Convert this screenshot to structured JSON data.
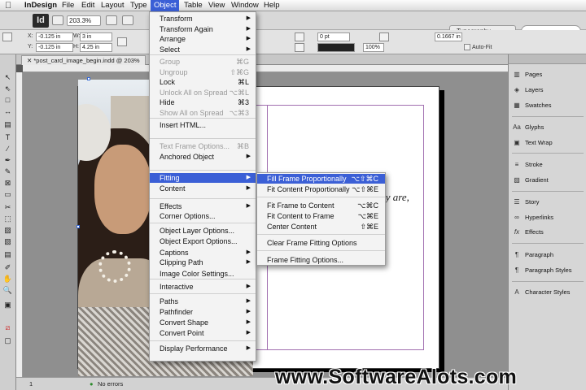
{
  "menubar": {
    "apple": "",
    "items": [
      "InDesign",
      "File",
      "Edit",
      "Layout",
      "Type",
      "Object",
      "Table",
      "View",
      "Window",
      "Help"
    ]
  },
  "toolbar": {
    "logo": "Id",
    "zoom": "203.3%",
    "workspace": "Typography"
  },
  "control": {
    "x_label": "X:",
    "x_value": "-0.125 in",
    "y_label": "Y:",
    "y_value": "-0.125 in",
    "w_label": "W:",
    "w_value": "3 in",
    "h_label": "H:",
    "h_value": "4.25 in",
    "stroke_weight": "0 pt",
    "percent": "100%",
    "measure": "0.1667 in",
    "autofit": "Auto-Fit"
  },
  "document_tab": "*post_card_image_begin.indd @ 203%",
  "canvas_text": "ey are,",
  "statusbar": {
    "page": "1",
    "errors": "No errors"
  },
  "watermark": "www.SoftwareAlots.com",
  "panels": [
    {
      "icon": "pages-icon",
      "label": "Pages"
    },
    {
      "icon": "layers-icon",
      "label": "Layers"
    },
    {
      "icon": "swatches-icon",
      "label": "Swatches"
    },
    {
      "icon": "glyphs-icon",
      "label": "Glyphs"
    },
    {
      "icon": "text-wrap-icon",
      "label": "Text Wrap"
    },
    {
      "icon": "stroke-icon",
      "label": "Stroke"
    },
    {
      "icon": "gradient-icon",
      "label": "Gradient"
    },
    {
      "icon": "story-icon",
      "label": "Story"
    },
    {
      "icon": "hyperlinks-icon",
      "label": "Hyperlinks"
    },
    {
      "icon": "effects-icon",
      "label": "Effects"
    },
    {
      "icon": "paragraph-icon",
      "label": "Paragraph"
    },
    {
      "icon": "paragraph-styles-icon",
      "label": "Paragraph Styles"
    },
    {
      "icon": "character-styles-icon",
      "label": "Character Styles"
    }
  ],
  "object_menu": [
    {
      "label": "Transform",
      "shortcut": "",
      "submenu": true,
      "disabled": false
    },
    {
      "label": "Transform Again",
      "shortcut": "",
      "submenu": true,
      "disabled": false
    },
    {
      "label": "Arrange",
      "shortcut": "",
      "submenu": true,
      "disabled": false
    },
    {
      "label": "Select",
      "shortcut": "",
      "submenu": true,
      "disabled": false
    },
    {
      "label": "Group",
      "shortcut": "⌘G",
      "submenu": false,
      "disabled": true
    },
    {
      "label": "Ungroup",
      "shortcut": "⇧⌘G",
      "submenu": false,
      "disabled": true
    },
    {
      "label": "Lock",
      "shortcut": "⌘L",
      "submenu": false,
      "disabled": false
    },
    {
      "label": "Unlock All on Spread",
      "shortcut": "⌥⌘L",
      "submenu": false,
      "disabled": true
    },
    {
      "label": "Hide",
      "shortcut": "⌘3",
      "submenu": false,
      "disabled": false
    },
    {
      "label": "Show All on Spread",
      "shortcut": "⌥⌘3",
      "submenu": false,
      "disabled": true
    },
    {
      "label": "Insert HTML...",
      "shortcut": "",
      "submenu": false,
      "disabled": false
    },
    {
      "label": "Text Frame Options...",
      "shortcut": "⌘B",
      "submenu": false,
      "disabled": true
    },
    {
      "label": "Anchored Object",
      "shortcut": "",
      "submenu": true,
      "disabled": false
    },
    {
      "label": "Fitting",
      "shortcut": "",
      "submenu": true,
      "disabled": false,
      "highlighted": true
    },
    {
      "label": "Content",
      "shortcut": "",
      "submenu": true,
      "disabled": false
    },
    {
      "label": "Effects",
      "shortcut": "",
      "submenu": true,
      "disabled": false
    },
    {
      "label": "Corner Options...",
      "shortcut": "",
      "submenu": false,
      "disabled": false
    },
    {
      "label": "Object Layer Options...",
      "shortcut": "",
      "submenu": false,
      "disabled": false
    },
    {
      "label": "Object Export Options...",
      "shortcut": "",
      "submenu": false,
      "disabled": false
    },
    {
      "label": "Captions",
      "shortcut": "",
      "submenu": true,
      "disabled": false
    },
    {
      "label": "Clipping Path",
      "shortcut": "",
      "submenu": true,
      "disabled": false
    },
    {
      "label": "Image Color Settings...",
      "shortcut": "",
      "submenu": false,
      "disabled": false
    },
    {
      "label": "Interactive",
      "shortcut": "",
      "submenu": true,
      "disabled": false
    },
    {
      "label": "Paths",
      "shortcut": "",
      "submenu": true,
      "disabled": false
    },
    {
      "label": "Pathfinder",
      "shortcut": "",
      "submenu": true,
      "disabled": false
    },
    {
      "label": "Convert Shape",
      "shortcut": "",
      "submenu": true,
      "disabled": false
    },
    {
      "label": "Convert Point",
      "shortcut": "",
      "submenu": true,
      "disabled": false
    },
    {
      "label": "Display Performance",
      "shortcut": "",
      "submenu": true,
      "disabled": false
    }
  ],
  "fitting_menu": [
    {
      "label": "Fill Frame Proportionally",
      "shortcut": "⌥⇧⌘C",
      "highlighted": true
    },
    {
      "label": "Fit Content Proportionally",
      "shortcut": "⌥⇧⌘E"
    },
    {
      "label": "Fit Frame to Content",
      "shortcut": "⌥⌘C"
    },
    {
      "label": "Fit Content to Frame",
      "shortcut": "⌥⌘E"
    },
    {
      "label": "Center Content",
      "shortcut": "⇧⌘E"
    },
    {
      "label": "Clear Frame Fitting Options",
      "shortcut": ""
    },
    {
      "label": "Frame Fitting Options...",
      "shortcut": ""
    }
  ]
}
